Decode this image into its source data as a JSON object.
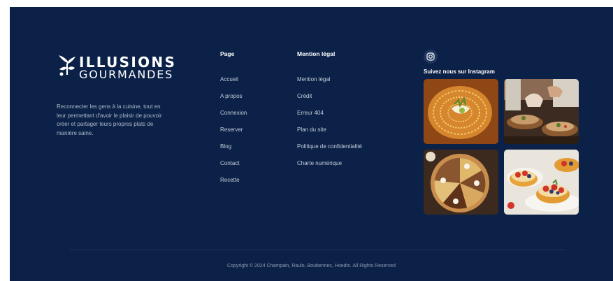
{
  "brand": {
    "logo_line1": "ILLUSIONS",
    "logo_line2": "GOURMANDES",
    "tagline": "Reconnecter les gens à la cuisine, tout en leur permettant d'avoir le plaisir de pouvoir créer et partager leurs propres plats de manière saine."
  },
  "page_column": {
    "title": "Page",
    "links": [
      "Accueil",
      "A propos",
      "Connexion",
      "Reserver",
      "Blog",
      "Contact",
      "Recette"
    ]
  },
  "legal_column": {
    "title": "Mention légal",
    "links": [
      "Mention légal",
      "Crédit",
      "Erreur 404",
      "Plan du site",
      "Politique de confidentialité",
      "Charte numérique"
    ]
  },
  "instagram": {
    "icon": "instagram-icon",
    "title": "Suivez  nous sur Instagram",
    "photos": [
      "caramel-lace-dessert-photo",
      "chefs-plating-photo",
      "sliced-pie-photo",
      "fruit-tartlets-photo"
    ]
  },
  "footer": {
    "copyright": "Copyright © 2024 Champain, Raulo, Boubennec, Hoedts. All Rights Reserved"
  },
  "colors": {
    "background": "#0b2147",
    "text": "#dfe6f1",
    "accent": "#ffffff"
  }
}
